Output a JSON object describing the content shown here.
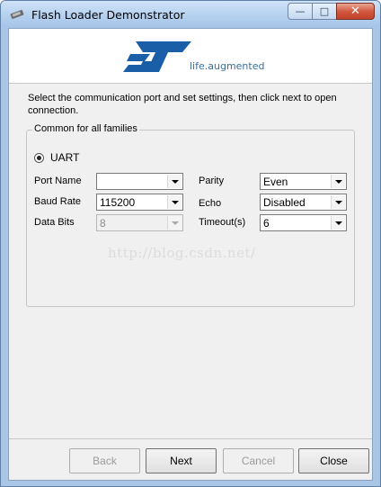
{
  "window": {
    "title": "Flash Loader Demonstrator",
    "buttons": {
      "minimize": "—",
      "maximize": "□",
      "close": "✕"
    }
  },
  "banner": {
    "logo_icon": "st-logo",
    "logo_text": "ST",
    "tagline": "life.augmented"
  },
  "instructions": "Select the communication port and set settings, then click next to open connection.",
  "group": {
    "legend": "Common for all families",
    "uart_label": "UART",
    "uart_selected": true,
    "fields": {
      "port_name": {
        "label": "Port Name",
        "value": ""
      },
      "baud_rate": {
        "label": "Baud Rate",
        "value": "115200"
      },
      "data_bits": {
        "label": "Data Bits",
        "value": "8",
        "disabled": true
      },
      "parity": {
        "label": "Parity",
        "value": "Even"
      },
      "echo": {
        "label": "Echo",
        "value": "Disabled"
      },
      "timeout": {
        "label": "Timeout(s)",
        "value": "6"
      }
    }
  },
  "watermark": "http://blog.csdn.net/",
  "footer": {
    "back": "Back",
    "next": "Next",
    "cancel": "Cancel",
    "close": "Close"
  },
  "colors": {
    "logo_blue": "#1b5ea8",
    "tagline": "#3d6f9c",
    "titlebar": "#b3cfee"
  }
}
